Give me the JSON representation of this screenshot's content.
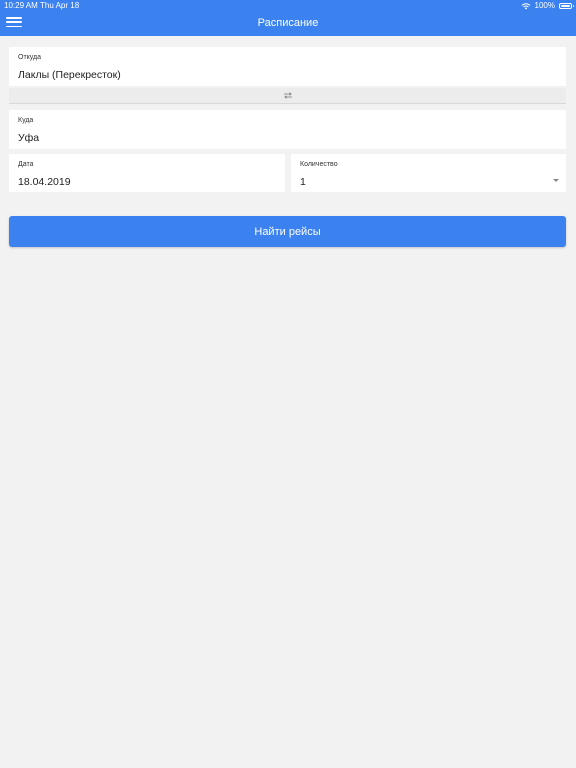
{
  "status_bar": {
    "time": "10:29 AM",
    "date": "Thu Apr 18",
    "battery": "100%"
  },
  "header": {
    "title": "Расписание"
  },
  "form": {
    "from": {
      "label": "Откуда",
      "value": "Лаклы (Перекресток)"
    },
    "to": {
      "label": "Куда",
      "value": "Уфа"
    },
    "date": {
      "label": "Дата",
      "value": "18.04.2019"
    },
    "quantity": {
      "label": "Количество",
      "value": "1"
    },
    "swap_icon": "swap-arrows-icon",
    "submit_label": "Найти рейсы"
  },
  "colors": {
    "accent": "#3b82f0",
    "background": "#f2f2f2"
  }
}
